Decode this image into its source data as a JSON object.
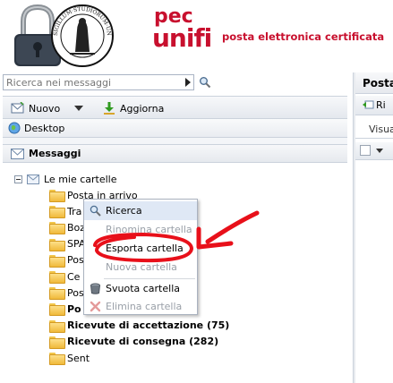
{
  "header": {
    "logo_pec": "pec",
    "logo_unifi": "unifi",
    "tagline": "posta elettronica certificata",
    "seal_text": "SIGILLUM·STUDIORUM·UNIVERSITATIS"
  },
  "search": {
    "placeholder": "Ricerca nei messaggi",
    "icon": "magnifier-icon"
  },
  "toolbar": {
    "new_label": "Nuovo",
    "refresh_label": "Aggiorna"
  },
  "desktop_label": "Desktop",
  "messages_label": "Messaggi",
  "tree": {
    "root_label": "Le mie cartelle",
    "folders": [
      {
        "label": "Posta in arrivo",
        "bold": false,
        "icon": "folder-icon"
      },
      {
        "label": "Tra",
        "bold": false,
        "icon": "folder-icon"
      },
      {
        "label": "Boz",
        "bold": false,
        "icon": "drafts-icon"
      },
      {
        "label": "SPA",
        "bold": false,
        "icon": "spam-icon"
      },
      {
        "label": "Pos",
        "bold": false,
        "icon": "outbox-icon"
      },
      {
        "label": "Ce",
        "bold": false,
        "icon": "trash-icon"
      },
      {
        "label": "Pos",
        "bold": false,
        "icon": "folder-icon"
      },
      {
        "label": "Po",
        "bold": true,
        "icon": "folder-icon"
      },
      {
        "label": "Ricevute di accettazione (75)",
        "bold": true,
        "icon": "folder-icon"
      },
      {
        "label": "Ricevute di consegna (282)",
        "bold": true,
        "icon": "folder-icon"
      },
      {
        "label": "Sent",
        "bold": false,
        "icon": "folder-icon"
      }
    ]
  },
  "context_menu": {
    "items": [
      {
        "label": "Ricerca",
        "disabled": false,
        "icon": "search-icon"
      },
      {
        "label": "Rinomina cartella",
        "disabled": true,
        "icon": ""
      },
      {
        "label": "Esporta cartella",
        "disabled": false,
        "icon": ""
      },
      {
        "label": "Nuova cartella",
        "disabled": true,
        "icon": ""
      },
      {
        "label": "Svuota cartella",
        "disabled": false,
        "icon": "empty-bin-icon"
      },
      {
        "label": "Elimina cartella",
        "disabled": true,
        "icon": "delete-x-icon"
      }
    ]
  },
  "right_panel": {
    "title": "Posta",
    "toolbar_label": "Ri",
    "view_label": "Visua"
  },
  "colors": {
    "brand_red": "#c8102e",
    "annotation_red": "#e8101a",
    "menu_highlight": "#dfe8f5"
  }
}
